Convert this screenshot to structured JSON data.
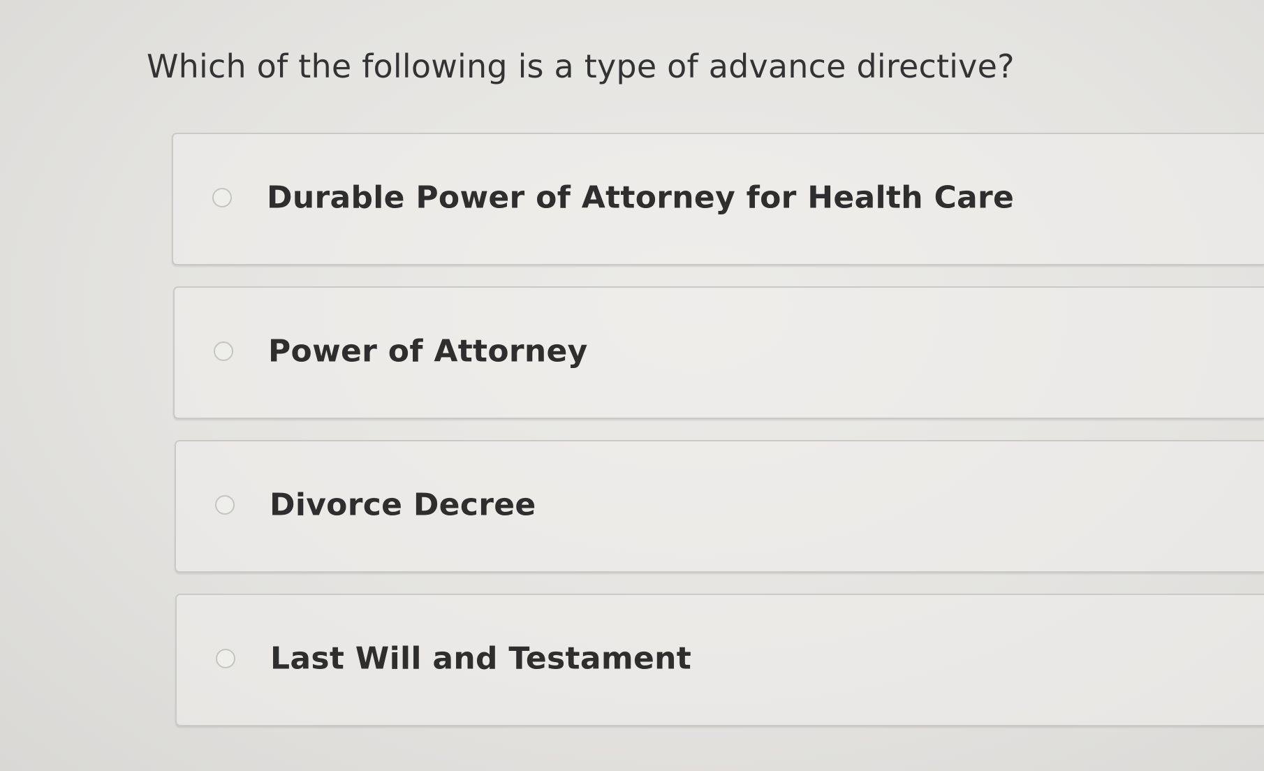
{
  "question": {
    "text": "Which of the following is a type of advance directive?"
  },
  "options": [
    {
      "label": "Durable Power of Attorney for Health Care",
      "selected": false
    },
    {
      "label": "Power of Attorney",
      "selected": false
    },
    {
      "label": "Divorce Decree",
      "selected": false
    },
    {
      "label": "Last Will and Testament",
      "selected": false
    }
  ]
}
